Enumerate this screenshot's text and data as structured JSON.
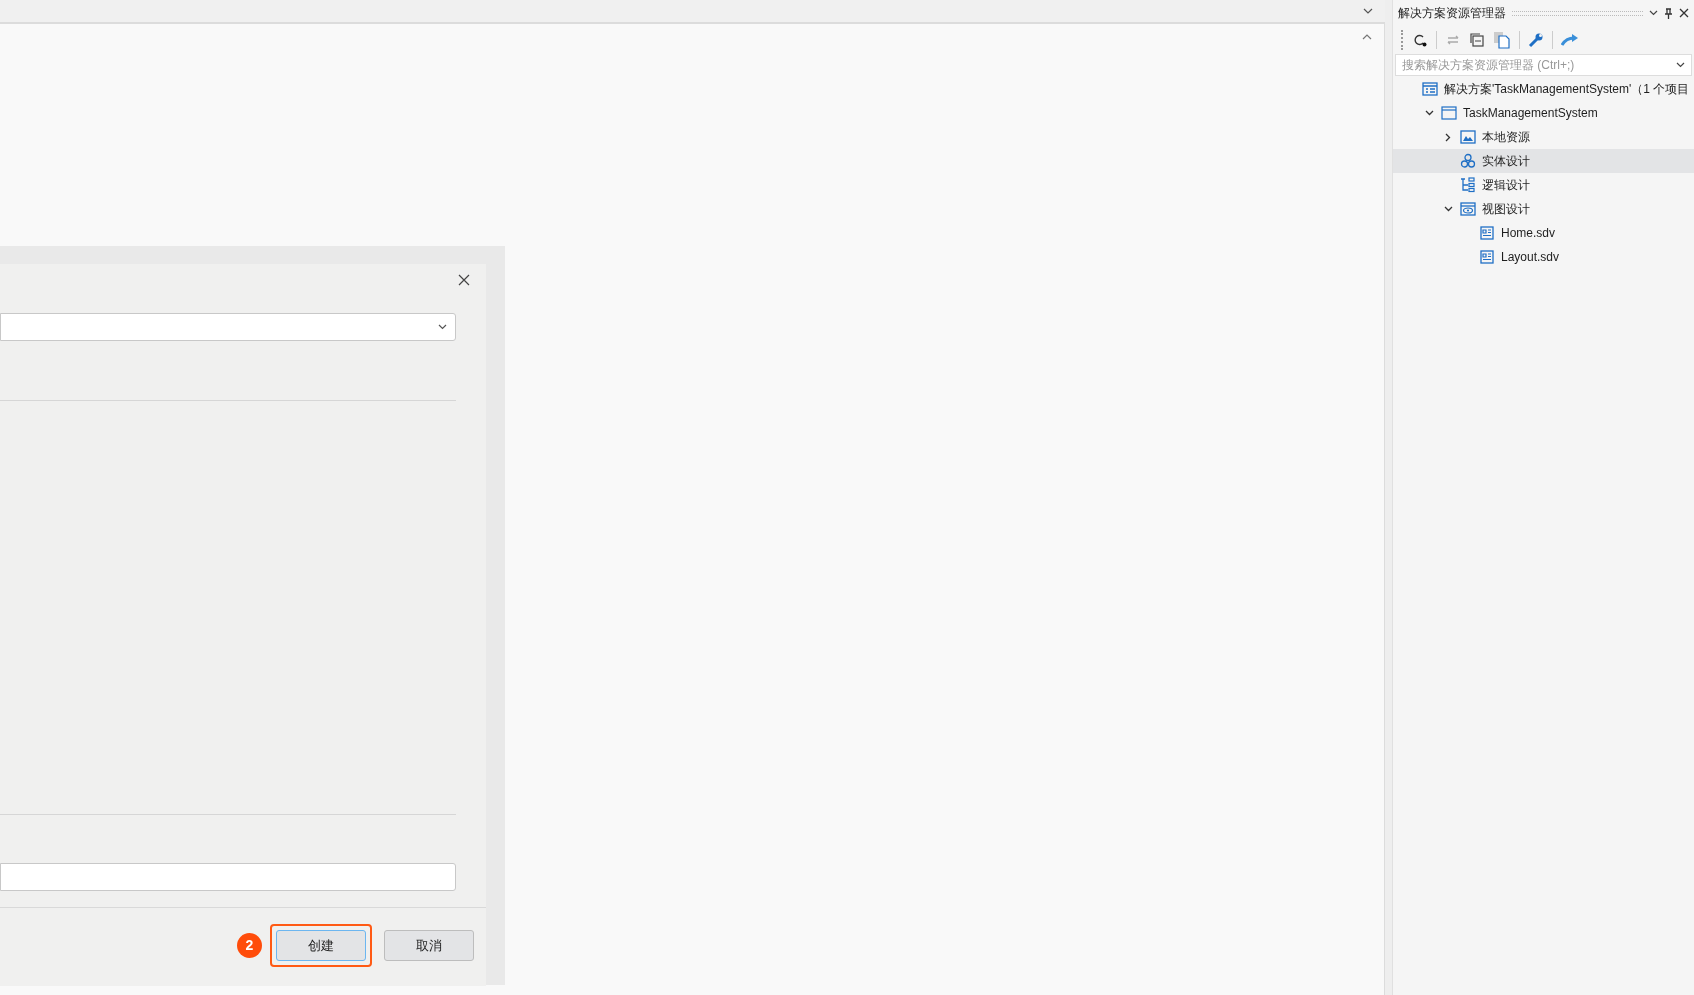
{
  "solution_explorer": {
    "title": "解决方案资源管理器",
    "search": {
      "placeholder": "搜索解决方案资源管理器 (Ctrl+;)"
    },
    "tree": [
      {
        "label": "解决方案'TaskManagementSystem'（1 个项目",
        "kind": "solution",
        "selected": false,
        "children": [
          {
            "label": "TaskManagementSystem",
            "kind": "project",
            "selected": false,
            "expanded": true,
            "children": [
              {
                "label": "本地资源",
                "kind": "resources",
                "selected": false,
                "expanded": false
              },
              {
                "label": "实体设计",
                "kind": "entity",
                "selected": true
              },
              {
                "label": "逻辑设计",
                "kind": "logic",
                "selected": false
              },
              {
                "label": "视图设计",
                "kind": "view",
                "selected": false,
                "expanded": true,
                "children": [
                  {
                    "label": "Home.sdv",
                    "kind": "file",
                    "selected": false
                  },
                  {
                    "label": "Layout.sdv",
                    "kind": "file",
                    "selected": false
                  }
                ]
              }
            ]
          }
        ]
      }
    ]
  },
  "dialog": {
    "step_badge": "2",
    "buttons": [
      {
        "label": "创建",
        "highlighted": true
      },
      {
        "label": "取消",
        "highlighted": false
      }
    ]
  }
}
